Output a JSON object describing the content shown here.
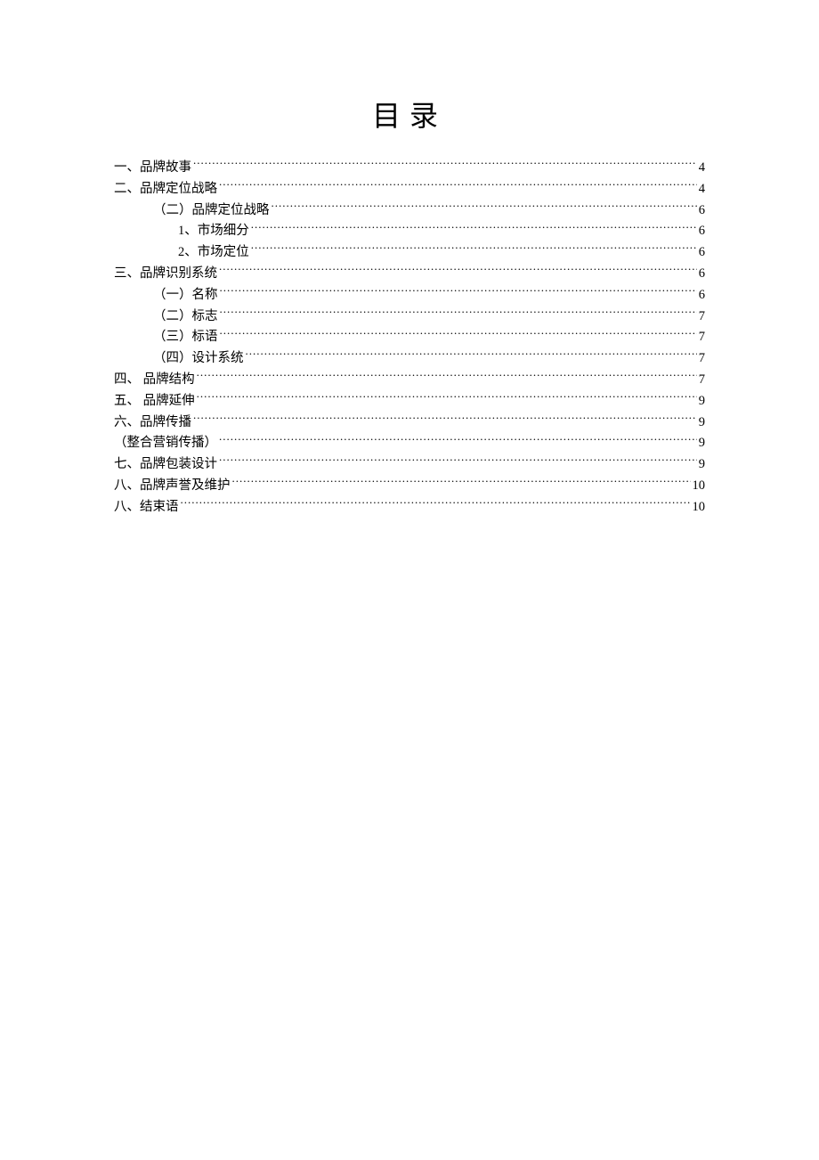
{
  "title": "目录",
  "entries": [
    {
      "label": "一、品牌故事",
      "page": "4",
      "indent": 0
    },
    {
      "label": "二、品牌定位战略",
      "page": "4",
      "indent": 0
    },
    {
      "label": "（二）品牌定位战略",
      "page": "6",
      "indent": 1
    },
    {
      "label": "1、市场细分",
      "page": "6",
      "indent": 2
    },
    {
      "label": "2、市场定位",
      "page": "6",
      "indent": 2
    },
    {
      "label": "三、品牌识别系统",
      "page": "6",
      "indent": 0
    },
    {
      "label": "（一）名称",
      "page": "6",
      "indent": 1
    },
    {
      "label": "（二）标志",
      "page": "7",
      "indent": 1
    },
    {
      "label": "（三）标语",
      "page": "7",
      "indent": 1
    },
    {
      "label": "（四）设计系统",
      "page": "7",
      "indent": 1
    },
    {
      "label": "四、 品牌结构",
      "page": "7",
      "indent": 0
    },
    {
      "label": "五、 品牌延伸",
      "page": "9",
      "indent": 0
    },
    {
      "label": "六、品牌传播",
      "page": "9",
      "indent": 0
    },
    {
      "label": "（整合营销传播）",
      "page": "9",
      "indent": 0
    },
    {
      "label": "七、品牌包装设计",
      "page": "9",
      "indent": 0
    },
    {
      "label": "八、品牌声誉及维护",
      "page": "10",
      "indent": 0
    },
    {
      "label": "八、结束语",
      "page": "10",
      "indent": 0
    }
  ]
}
